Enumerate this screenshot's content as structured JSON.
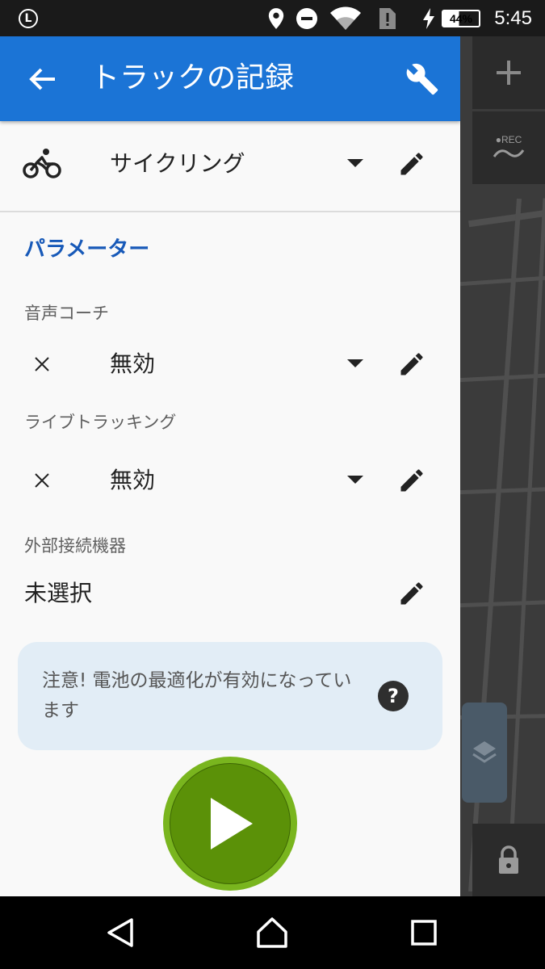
{
  "status_bar": {
    "launcher_letter": "L",
    "battery": "44%",
    "time": "5:45",
    "icons": [
      "location-icon",
      "do-not-disturb-icon",
      "wifi-icon",
      "sim-alert-icon",
      "charging-icon"
    ]
  },
  "app_bar": {
    "title": "トラックの記録",
    "back_icon": "arrow-back-icon",
    "settings_icon": "wrench-icon"
  },
  "activity": {
    "icon": "bicycle-icon",
    "value": "サイクリング"
  },
  "parameters": {
    "section_title": "パラメーター",
    "voice_coach": {
      "label": "音声コーチ",
      "value": "無効"
    },
    "live_tracking": {
      "label": "ライブトラッキング",
      "value": "無効"
    },
    "external_devices": {
      "label": "外部接続機器",
      "value": "未選択"
    }
  },
  "notice": {
    "text": "注意! 電池の最適化が有効になっています",
    "help_glyph": "?"
  },
  "map_overlay": {
    "rec_label": "●REC"
  },
  "colors": {
    "app_bar": "#1b74d6",
    "section_title": "#1759b8",
    "play_button": "#5b9108",
    "notice_bg": "#e2edf6"
  }
}
